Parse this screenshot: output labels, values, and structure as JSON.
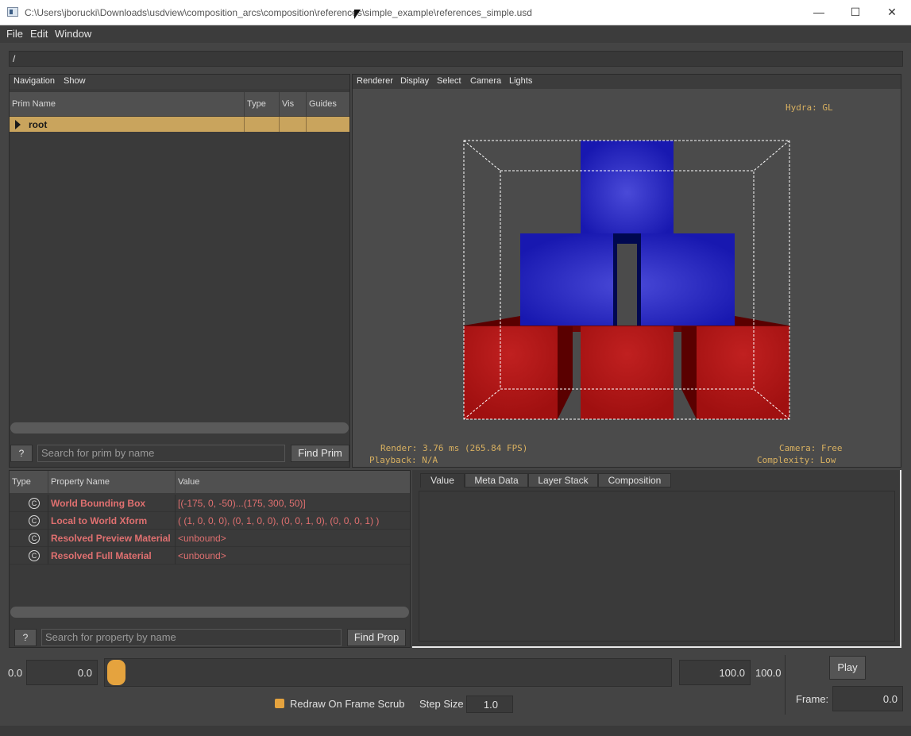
{
  "window": {
    "title": "C:\\Users\\jborucki\\Downloads\\usdview\\composition_arcs\\composition\\references\\simple_example\\references_simple.usd",
    "minimize": "—",
    "maximize": "☐",
    "close": "✕"
  },
  "menubar": {
    "items": [
      "File",
      "Edit",
      "Window"
    ]
  },
  "path": {
    "value": "/"
  },
  "prim_panel": {
    "menu": [
      "Navigation",
      "Show"
    ],
    "columns": [
      "Prim Name",
      "Type",
      "Vis",
      "Guides"
    ],
    "rows": [
      {
        "name": "root",
        "type": "",
        "vis": "",
        "guides": ""
      }
    ],
    "help_label": "?",
    "search_placeholder": "Search for prim by name",
    "find_label": "Find Prim"
  },
  "viewport": {
    "menu": [
      "Renderer",
      "Display",
      "Select",
      "Camera",
      "Lights"
    ],
    "hud_renderer": "Hydra: GL",
    "hud_render": "Render: 3.76 ms (265.84 FPS)",
    "hud_playback": "Playback: N/A",
    "hud_camera": "Camera: Free",
    "hud_complexity": "Complexity: Low",
    "colors": {
      "blue": "#1a1ab0",
      "red": "#a01010",
      "hud": "#d8b060"
    }
  },
  "property_panel": {
    "columns": [
      "Type",
      "Property Name",
      "Value"
    ],
    "rows": [
      {
        "icon": "computed-icon",
        "icon_glyph": "C",
        "name": "World Bounding Box",
        "value": "[(-175, 0, -50)...(175, 300, 50)]"
      },
      {
        "icon": "computed-icon",
        "icon_glyph": "C",
        "name": "Local to World Xform",
        "value": "( (1, 0, 0, 0), (0, 1, 0, 0), (0, 0, 1, 0), (0, 0, 0, 1) )"
      },
      {
        "icon": "computed-icon",
        "icon_glyph": "C",
        "name": "Resolved Preview Material",
        "value": "<unbound>"
      },
      {
        "icon": "computed-icon",
        "icon_glyph": "C",
        "name": "Resolved Full Material",
        "value": "<unbound>"
      }
    ],
    "help_label": "?",
    "search_placeholder": "Search for property by name",
    "find_label": "Find Prop"
  },
  "value_panel": {
    "tabs": [
      "Value",
      "Meta Data",
      "Layer Stack",
      "Composition"
    ],
    "active_tab": "Value"
  },
  "timeline": {
    "start_label": "0.0",
    "start_value": "0.0",
    "end_value": "100.0",
    "end_label": "100.0",
    "slider_fraction": 0.0,
    "play_label": "Play",
    "redraw_label": "Redraw On Frame Scrub",
    "redraw_checked": true,
    "step_label": "Step Size",
    "step_value": "1.0",
    "frame_label": "Frame:",
    "frame_value": "0.0"
  }
}
